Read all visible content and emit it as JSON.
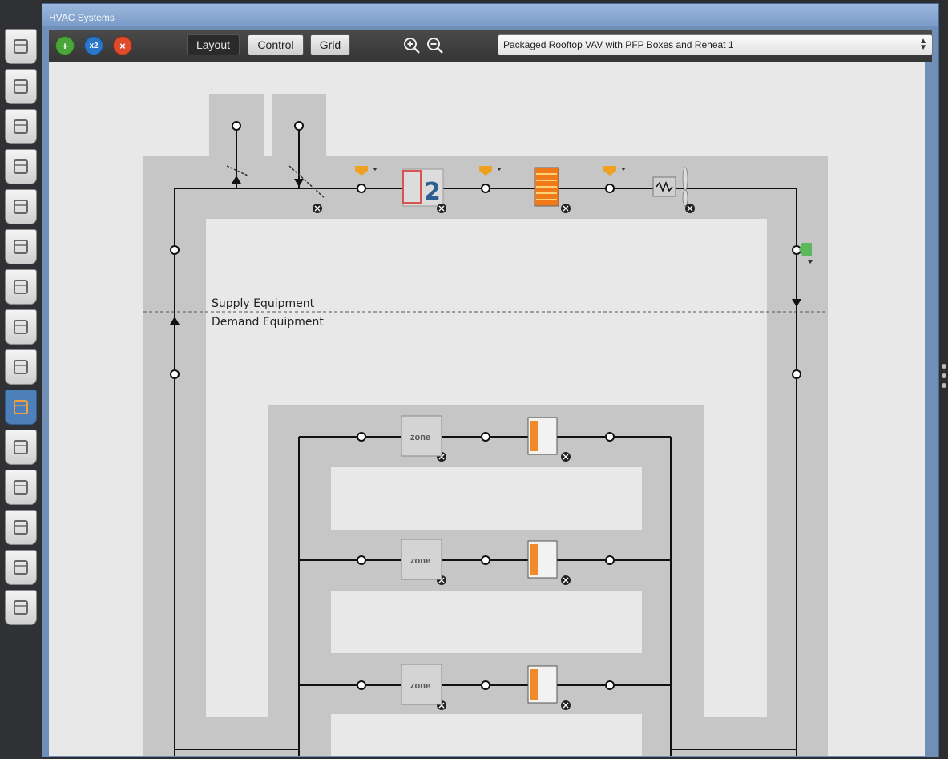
{
  "window": {
    "title": "HVAC Systems"
  },
  "sidebar": {
    "tabs": [
      {
        "icon": "globe-icon"
      },
      {
        "icon": "calendar-icon"
      },
      {
        "icon": "constructions-icon"
      },
      {
        "icon": "loads-icon"
      },
      {
        "icon": "space-types-icon"
      },
      {
        "icon": "geometry-icon"
      },
      {
        "icon": "facility-icon"
      },
      {
        "icon": "spaces-icon"
      },
      {
        "icon": "thermal-zones-icon"
      },
      {
        "icon": "hvac-systems-icon",
        "active": true
      },
      {
        "icon": "variables-icon"
      },
      {
        "icon": "simulation-settings-icon"
      },
      {
        "icon": "scripts-icon"
      },
      {
        "icon": "run-icon"
      },
      {
        "icon": "results-icon"
      }
    ]
  },
  "toolbar": {
    "add_label": "+",
    "copy_label": "x2",
    "delete_label": "×",
    "layout_label": "Layout",
    "control_label": "Control",
    "grid_label": "Grid",
    "selected_view": "Layout",
    "system_select_value": "Packaged Rooftop VAV with PFP Boxes and Reheat 1"
  },
  "diagram": {
    "supply_label": "Supply Equipment",
    "demand_label": "Demand Equipment",
    "zone_label": "zone",
    "supply_components": [
      "outdoor-air-mixer",
      "dx-coil-2-speed",
      "heating-coil",
      "supply-fan"
    ],
    "zone_branches": 3
  },
  "colors": {
    "loop_band": "#c6c6c6",
    "canvas": "#e8e8e8",
    "accent": "#4d7fb8"
  }
}
